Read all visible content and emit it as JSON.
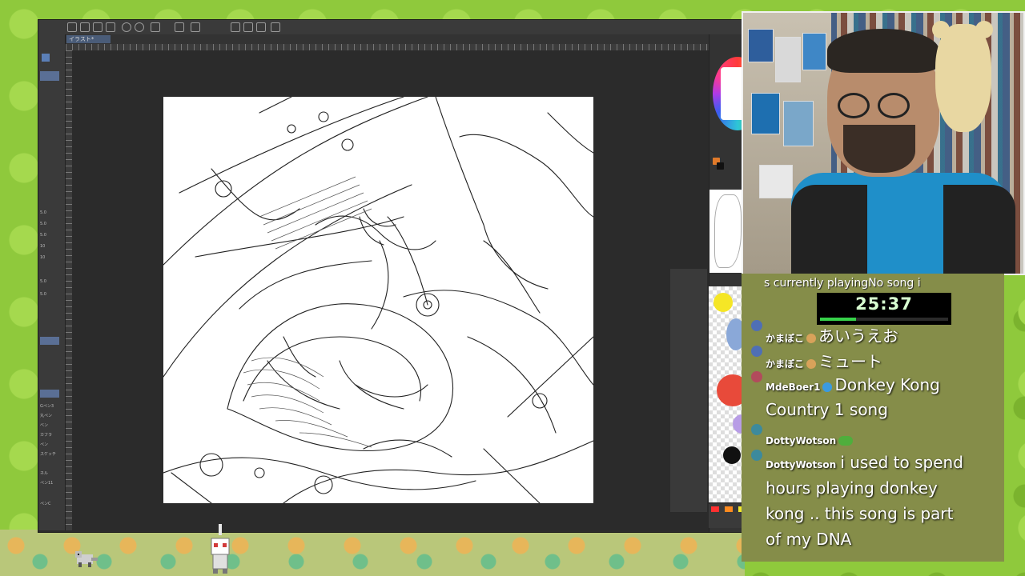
{
  "app": {
    "tab_label": "イラスト*",
    "left_panel_labels": [
      "5.0",
      "5.0",
      "5.0",
      "10",
      "10",
      "5.0",
      "5.0",
      "Gペン3",
      "丸ペン",
      "ベン",
      "カブラ",
      "ペン",
      "スケッチ",
      "ネル",
      "ペン11",
      "ペンC"
    ],
    "palette_colors": [
      "#f5e626",
      "#8aa8d8",
      "#f0b25c",
      "#e84a3a",
      "#111111",
      "#ff6c6c",
      "#b89de6"
    ],
    "palette_chips": [
      "#ff3030",
      "#ff8a1f",
      "#f0e62a",
      "#5fd24a",
      "#2e7bf0"
    ]
  },
  "overlay": {
    "now_playing": "s currently playingNo song i",
    "timer": "25:37",
    "timer_progress": 0.28
  },
  "chat": [
    {
      "user": "かまぼこ",
      "message": "あいうえお",
      "badge_color": "#d8a25a"
    },
    {
      "user": "かまぼこ",
      "message": "ミュート",
      "badge_color": "#d8a25a"
    },
    {
      "user": "MdeBoer1",
      "message": "Donkey Kong",
      "message_cont": "Country 1 song",
      "badge_color": "#3a9ae0"
    },
    {
      "user": "DottyWotson",
      "message": "",
      "badge_color": "#4fae3c"
    },
    {
      "user": "DottyWotson",
      "message": "i used to spend",
      "message_cont": "hours playing donkey",
      "message_cont2": "kong .. this song is part",
      "message_cont3": "of my DNA"
    }
  ],
  "icons": {
    "undo": "undo-icon",
    "redo": "redo-icon",
    "save": "save-icon",
    "pencil": "pencil-icon"
  }
}
